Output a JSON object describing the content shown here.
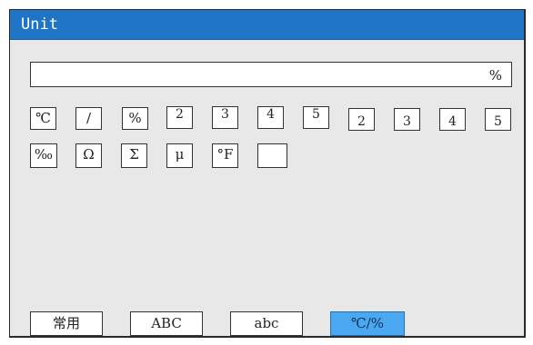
{
  "window": {
    "title": "Unit"
  },
  "unit_field": {
    "value": "%"
  },
  "row1": [
    "℃",
    "/",
    "%",
    "2",
    "3",
    "4",
    "5",
    "2",
    "3",
    "4",
    "5"
  ],
  "row2": [
    "‰",
    "Ω",
    "Σ",
    "μ",
    "°F",
    ""
  ],
  "tabs": [
    {
      "label": "常用",
      "active": false
    },
    {
      "label": "ABC",
      "active": false
    },
    {
      "label": "abc",
      "active": false
    },
    {
      "label": "℃/%",
      "active": true
    }
  ],
  "colors": {
    "titlebar": "#1f74c6",
    "active_tab": "#4aa8f0",
    "panel": "#e8e8e8"
  }
}
